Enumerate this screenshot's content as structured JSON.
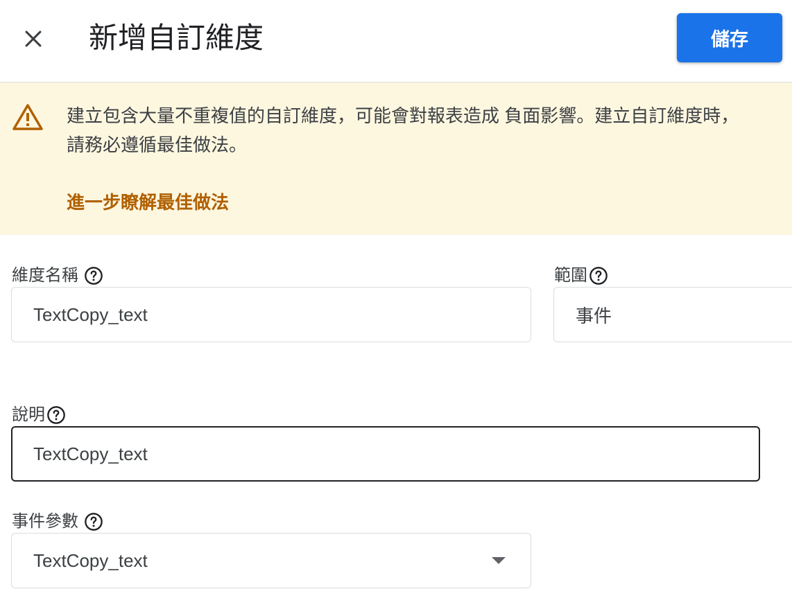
{
  "header": {
    "title": "新增自訂維度",
    "save_label": "儲存"
  },
  "banner": {
    "message": "建立包含大量不重複值的自訂維度，可能會對報表造成 負面影響。建立自訂維度時，請務必遵循最佳做法。",
    "link_text": "進一步瞭解最佳做法"
  },
  "form": {
    "dimension_name": {
      "label": "維度名稱",
      "value": "TextCopy_text"
    },
    "scope": {
      "label": "範圍",
      "value": "事件"
    },
    "description": {
      "label": "說明",
      "value": "TextCopy_text"
    },
    "event_parameter": {
      "label": "事件參數",
      "value": "TextCopy_text"
    }
  },
  "colors": {
    "primary": "#1a73e8",
    "banner_bg": "#fef7e0",
    "warning_icon": "#b06000",
    "link": "#b06000",
    "text": "#202124"
  },
  "icons": {
    "close": "close-icon",
    "warning": "warning-icon",
    "help": "help-circle-icon",
    "dropdown": "arrow-drop-down-icon"
  }
}
